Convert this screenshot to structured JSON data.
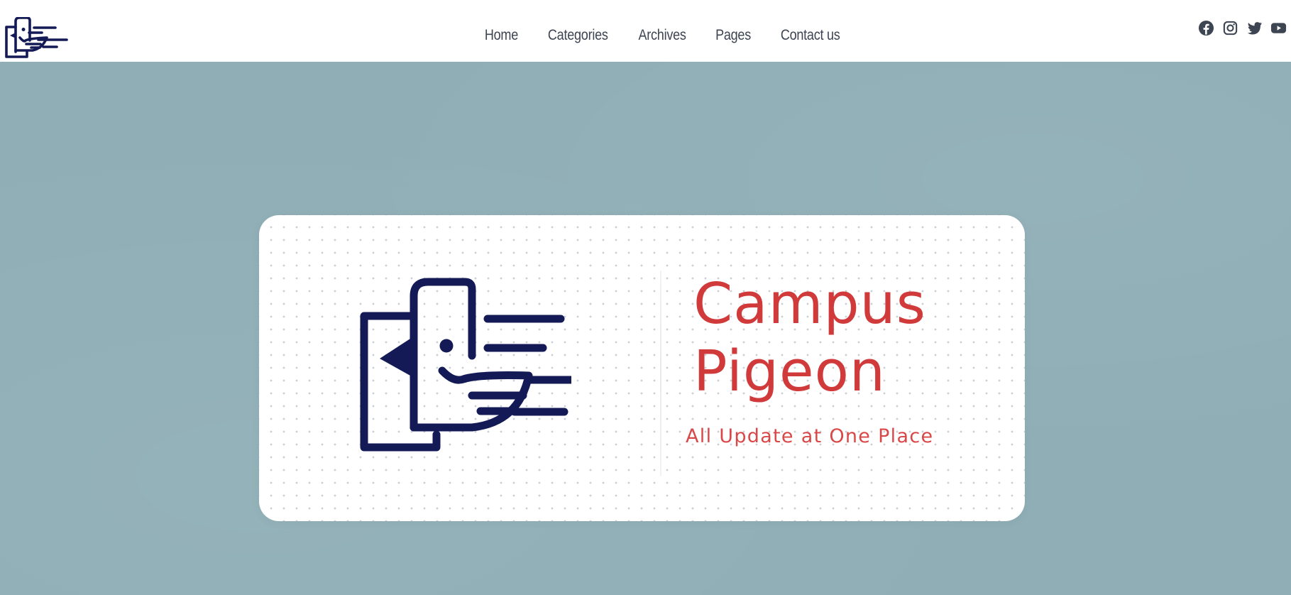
{
  "header": {
    "logo_icon": "campus-pigeon-logo-icon",
    "nav": [
      {
        "label": "Home"
      },
      {
        "label": "Categories"
      },
      {
        "label": "Archives"
      },
      {
        "label": "Pages"
      },
      {
        "label": "Contact us"
      }
    ],
    "social": [
      {
        "icon": "facebook-icon"
      },
      {
        "icon": "instagram-icon"
      },
      {
        "icon": "twitter-icon"
      },
      {
        "icon": "youtube-icon"
      }
    ]
  },
  "banner": {
    "logo_icon": "campus-pigeon-logo-icon",
    "brand_line1": "Campus",
    "brand_line2": "Pigeon",
    "tagline": "All Update at One Place"
  },
  "colors": {
    "background": "#8faeb6",
    "header": "#ffffff",
    "nav_text": "#3d4452",
    "logo_navy": "#131a55",
    "brand_red": "#d13a3a",
    "social_icons": "#3d4452"
  }
}
